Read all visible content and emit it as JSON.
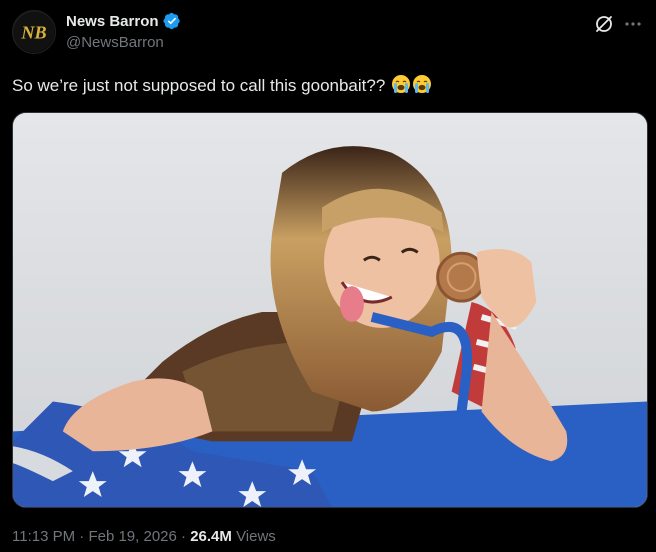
{
  "author": {
    "display_name": "News Barron",
    "handle": "@NewsBarron",
    "avatar_initials": "NB",
    "verified": true
  },
  "post": {
    "text": "So we’re just not supposed to call this goonbait??",
    "emojis": [
      "loudly-crying-face",
      "loudly-crying-face"
    ]
  },
  "meta": {
    "time": "11:13 PM",
    "separator": "·",
    "date": "Feb 19, 2026",
    "views_count": "26.4M",
    "views_label": "Views"
  },
  "colors": {
    "background": "#000000",
    "text_primary": "#e7e9ea",
    "text_secondary": "#71767b",
    "verified_blue": "#1d9bf0"
  },
  "icons": {
    "grok": "grok-icon",
    "more": "more-icon",
    "verified": "verified-badge-icon"
  }
}
